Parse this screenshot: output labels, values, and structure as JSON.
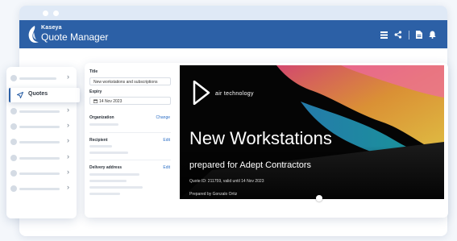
{
  "app": {
    "brand_small": "Kaseya",
    "brand_name": "Quote Manager"
  },
  "toolbar": {
    "icons": [
      "list-icon",
      "share-icon",
      "document-icon",
      "bell-icon"
    ]
  },
  "sidebar": {
    "active_label": "Quotes",
    "active_icon": "send-icon"
  },
  "form": {
    "title_label": "Title",
    "title_value": "New workstations and subscriptions",
    "expiry_label": "Expiry",
    "expiry_value": "14 Nov 2023",
    "organization_label": "Organization",
    "organization_action": "Change",
    "recipient_label": "Recipient",
    "recipient_action": "Edit",
    "delivery_label": "Delivery address",
    "delivery_action": "Edit"
  },
  "cover": {
    "brand": "air technology",
    "title": "New Workstations",
    "subtitle": "prepared for Adept Contractors",
    "meta": "Quote ID: 211759, valid until 14 Nov 2023",
    "prepared_by": "Prepared by Gonzalo Ortiz"
  },
  "colors": {
    "accent": "#2c60a6",
    "link": "#2c6fc6",
    "cover_bg": "#050505"
  }
}
